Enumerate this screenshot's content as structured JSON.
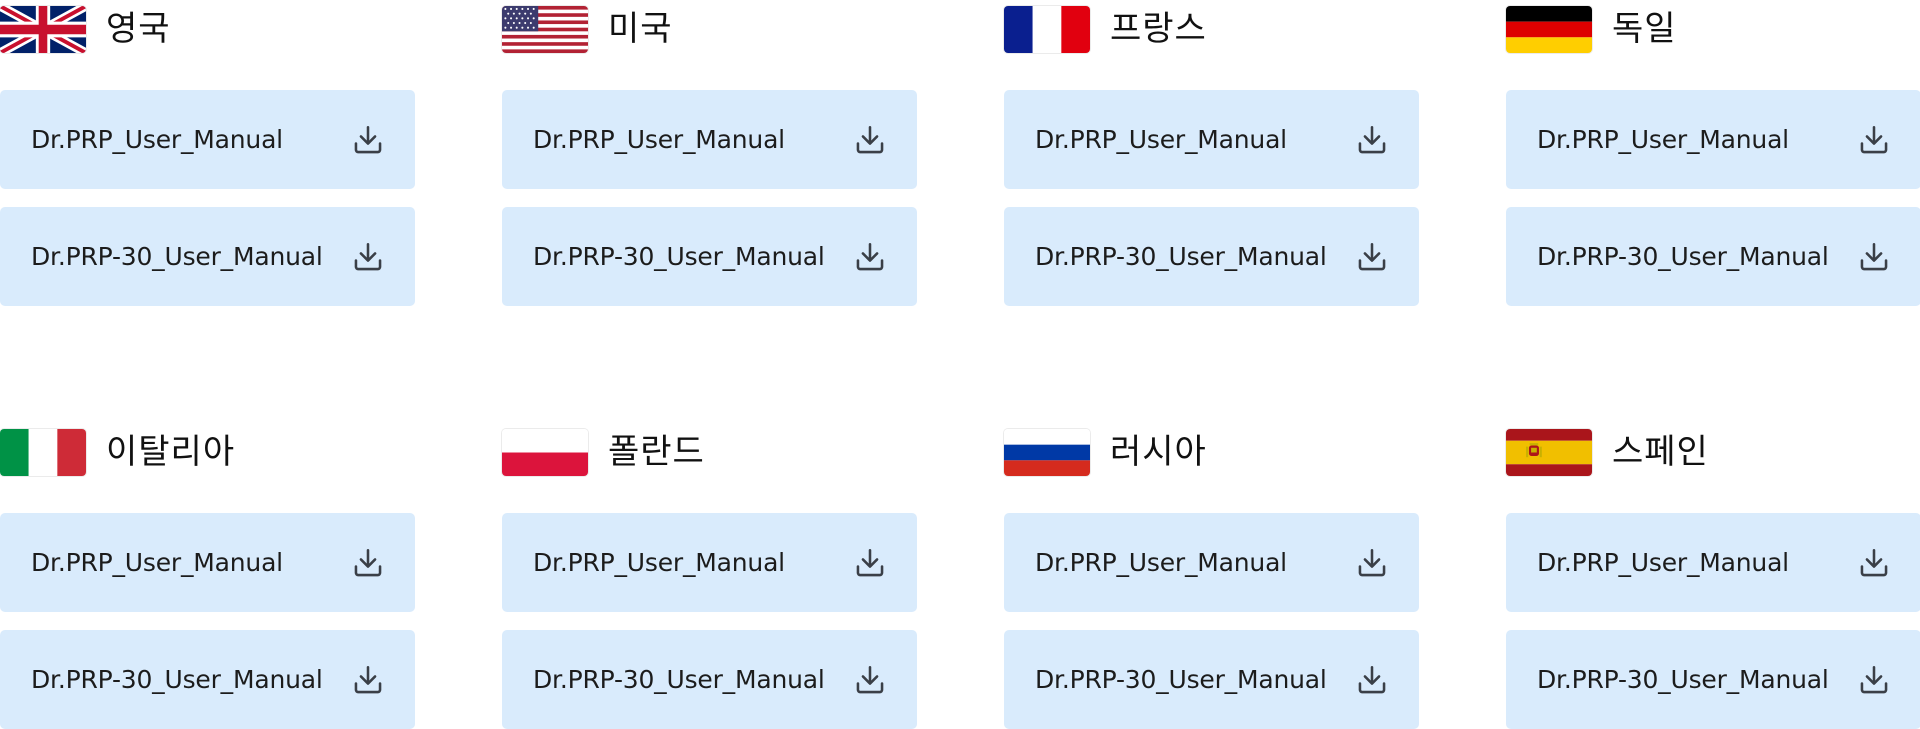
{
  "groups": [
    {
      "flag_icon": "uk-flag-icon",
      "country": "영국",
      "files": [
        {
          "label": "Dr.PRP_User_Manual",
          "icon": "download-icon"
        },
        {
          "label": "Dr.PRP-30_User_Manual",
          "icon": "download-icon"
        }
      ]
    },
    {
      "flag_icon": "us-flag-icon",
      "country": "미국",
      "files": [
        {
          "label": "Dr.PRP_User_Manual",
          "icon": "download-icon"
        },
        {
          "label": "Dr.PRP-30_User_Manual",
          "icon": "download-icon"
        }
      ]
    },
    {
      "flag_icon": "france-flag-icon",
      "country": "프랑스",
      "files": [
        {
          "label": "Dr.PRP_User_Manual",
          "icon": "download-icon"
        },
        {
          "label": "Dr.PRP-30_User_Manual",
          "icon": "download-icon"
        }
      ]
    },
    {
      "flag_icon": "germany-flag-icon",
      "country": "독일",
      "files": [
        {
          "label": "Dr.PRP_User_Manual",
          "icon": "download-icon"
        },
        {
          "label": "Dr.PRP-30_User_Manual",
          "icon": "download-icon"
        }
      ]
    },
    {
      "flag_icon": "italy-flag-icon",
      "country": "이탈리아",
      "files": [
        {
          "label": "Dr.PRP_User_Manual",
          "icon": "download-icon"
        },
        {
          "label": "Dr.PRP-30_User_Manual",
          "icon": "download-icon"
        }
      ]
    },
    {
      "flag_icon": "poland-flag-icon",
      "country": "폴란드",
      "files": [
        {
          "label": "Dr.PRP_User_Manual",
          "icon": "download-icon"
        },
        {
          "label": "Dr.PRP-30_User_Manual",
          "icon": "download-icon"
        }
      ]
    },
    {
      "flag_icon": "russia-flag-icon",
      "country": "러시아",
      "files": [
        {
          "label": "Dr.PRP_User_Manual",
          "icon": "download-icon"
        },
        {
          "label": "Dr.PRP-30_User_Manual",
          "icon": "download-icon"
        }
      ]
    },
    {
      "flag_icon": "spain-flag-icon",
      "country": "스페인",
      "files": [
        {
          "label": "Dr.PRP_User_Manual",
          "icon": "download-icon"
        },
        {
          "label": "Dr.PRP-30_User_Manual",
          "icon": "download-icon"
        }
      ]
    }
  ],
  "colors": {
    "button_bg": "#d9ebfc",
    "icon_stroke": "#3a3f47",
    "text": "#1c1c1c"
  }
}
